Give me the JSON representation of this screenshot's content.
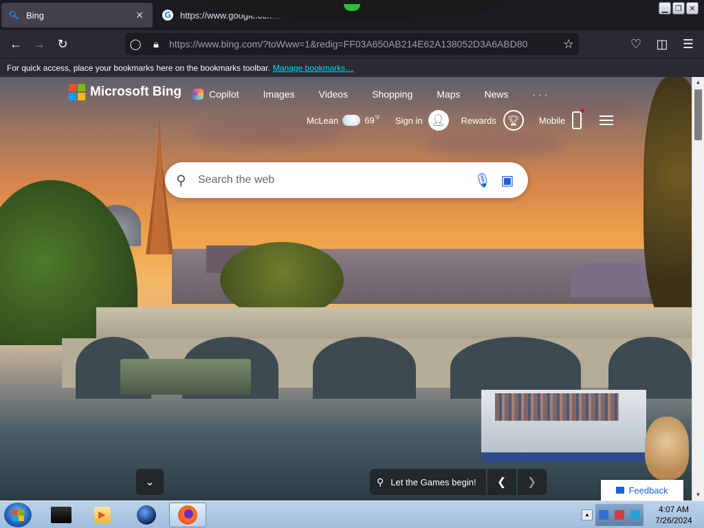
{
  "browser": {
    "tabs": [
      {
        "title": "Bing",
        "active": true,
        "favicon": "bing-icon"
      },
      {
        "title": "https://www.google.com/search",
        "active": false,
        "favicon": "google-icon"
      }
    ],
    "tab_close_glyph": "✕",
    "window_buttons": {
      "minimize": "▁",
      "restore": "❐",
      "close": "✕"
    },
    "url": "https://www.bing.com/?toWww=1&redig=FF03A650AB214E62A138052D3A6ABD80",
    "bookmarks_bar": {
      "message": "For quick access, place your bookmarks here on the bookmarks toolbar.",
      "link": "Manage bookmarks…"
    }
  },
  "bing": {
    "brand": "Microsoft Bing",
    "brand_colors": [
      "#f25022",
      "#7fba00",
      "#00a4ef",
      "#ffb900"
    ],
    "nav": {
      "copilot": "Copilot",
      "images": "Images",
      "videos": "Videos",
      "shopping": "Shopping",
      "maps": "Maps",
      "news": "News",
      "more": "· · ·"
    },
    "weather": {
      "location": "McLean",
      "temp": "69",
      "unit": "°F"
    },
    "signin": "Sign in",
    "rewards": "Rewards",
    "mobile": "Mobile",
    "search": {
      "placeholder": "Search the web"
    },
    "caption": "Let the Games begin!",
    "feedback": "Feedback"
  },
  "taskbar": {
    "apps": [
      "command-prompt-icon",
      "media-player-icon",
      "globe-icon",
      "firefox-icon"
    ],
    "time": "4:07 AM",
    "date": "7/26/2024"
  }
}
